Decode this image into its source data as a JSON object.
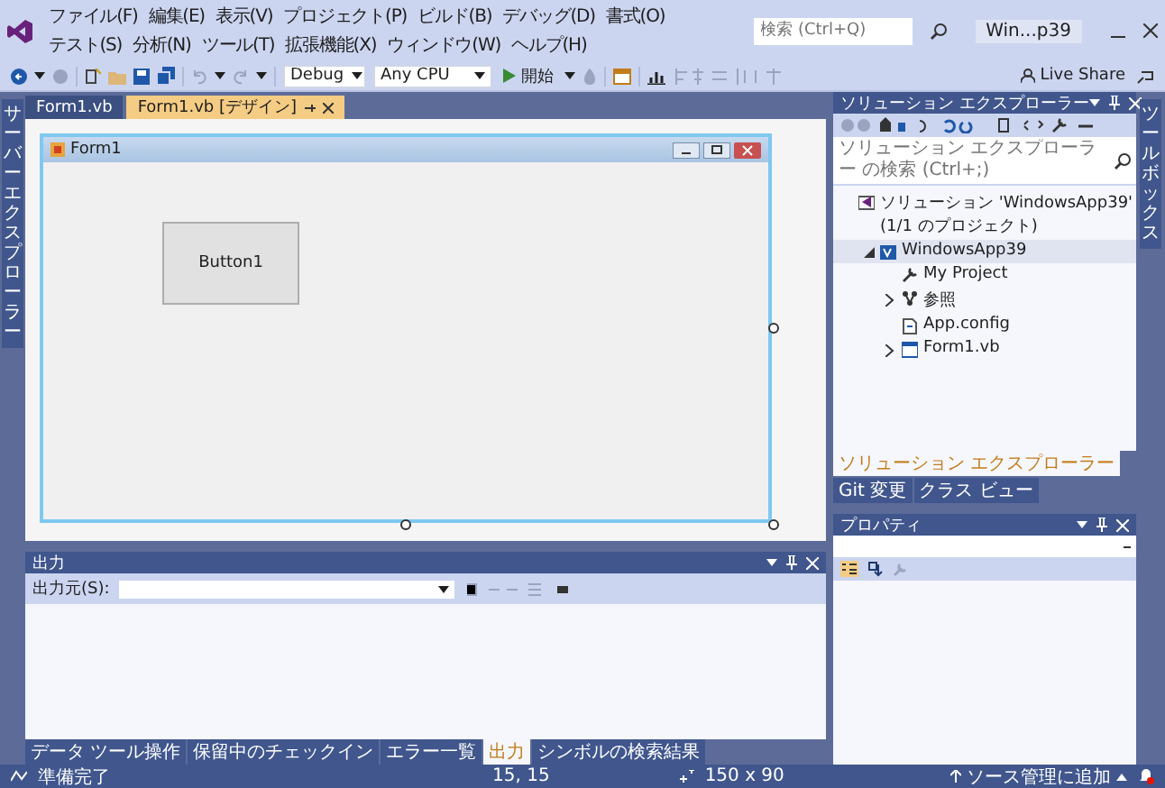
{
  "menu": [
    "ファイル(F)",
    "編集(E)",
    "表示(V)",
    "プロジェクト(P)",
    "ビルド(B)",
    "デバッグ(D)",
    "書式(O)",
    "テスト(S)",
    "分析(N)",
    "ツール(T)",
    "拡張機能(X)",
    "ウィンドウ(W)",
    "ヘルプ(H)"
  ],
  "search": {
    "placeholder": "検索 (Ctrl+Q)"
  },
  "solution_name": "Win...p39",
  "toolbar": {
    "configuration": "Debug",
    "platform": "Any CPU",
    "start": "開始",
    "live_share": "Live Share"
  },
  "left_strip": "サーバーエクスプローラー",
  "right_strip": "ツールボックス",
  "document_tabs": [
    {
      "label": "Form1.vb",
      "selected": false
    },
    {
      "label": "Form1.vb [デザイン]",
      "selected": true
    }
  ],
  "designer": {
    "form_title": "Form1",
    "button": "Button1"
  },
  "solution_explorer": {
    "title": "ソリューション エクスプローラー",
    "search": {
      "placeholder": "ソリューション エクスプローラー の検索 (Ctrl+;)"
    },
    "tree": [
      {
        "label": "ソリューション 'WindowsApp39' (1/1 のプロジェクト)",
        "kind": "solution",
        "selected": false,
        "children": [
          {
            "label": "WindowsApp39",
            "kind": "project",
            "selected": true,
            "expanded": true,
            "children": [
              {
                "label": "My Project",
                "kind": "settings",
                "selected": false
              },
              {
                "label": "参照",
                "kind": "references",
                "selected": false,
                "expanded": false
              },
              {
                "label": "App.config",
                "kind": "config",
                "selected": false
              },
              {
                "label": "Form1.vb",
                "kind": "form",
                "selected": false,
                "expanded": false
              }
            ]
          }
        ]
      }
    ],
    "tabs": [
      {
        "label": "ソリューション エクスプローラー",
        "selected": true
      },
      {
        "label": "Git 変更",
        "selected": false
      },
      {
        "label": "クラス ビュー",
        "selected": false
      }
    ]
  },
  "properties": {
    "title": "プロパティ"
  },
  "output": {
    "title": "出力",
    "source_label": "出力元(S):"
  },
  "bottom_tabs": [
    {
      "label": "データ ツール操作",
      "selected": false
    },
    {
      "label": "保留中のチェックイン",
      "selected": false
    },
    {
      "label": "エラー一覧",
      "selected": false
    },
    {
      "label": "出力",
      "selected": true
    },
    {
      "label": "シンボルの検索結果",
      "selected": false
    }
  ],
  "status": {
    "text": "準備完了",
    "position": "15, 15",
    "size": "150 x 90",
    "source_control": "ソース管理に追加"
  }
}
